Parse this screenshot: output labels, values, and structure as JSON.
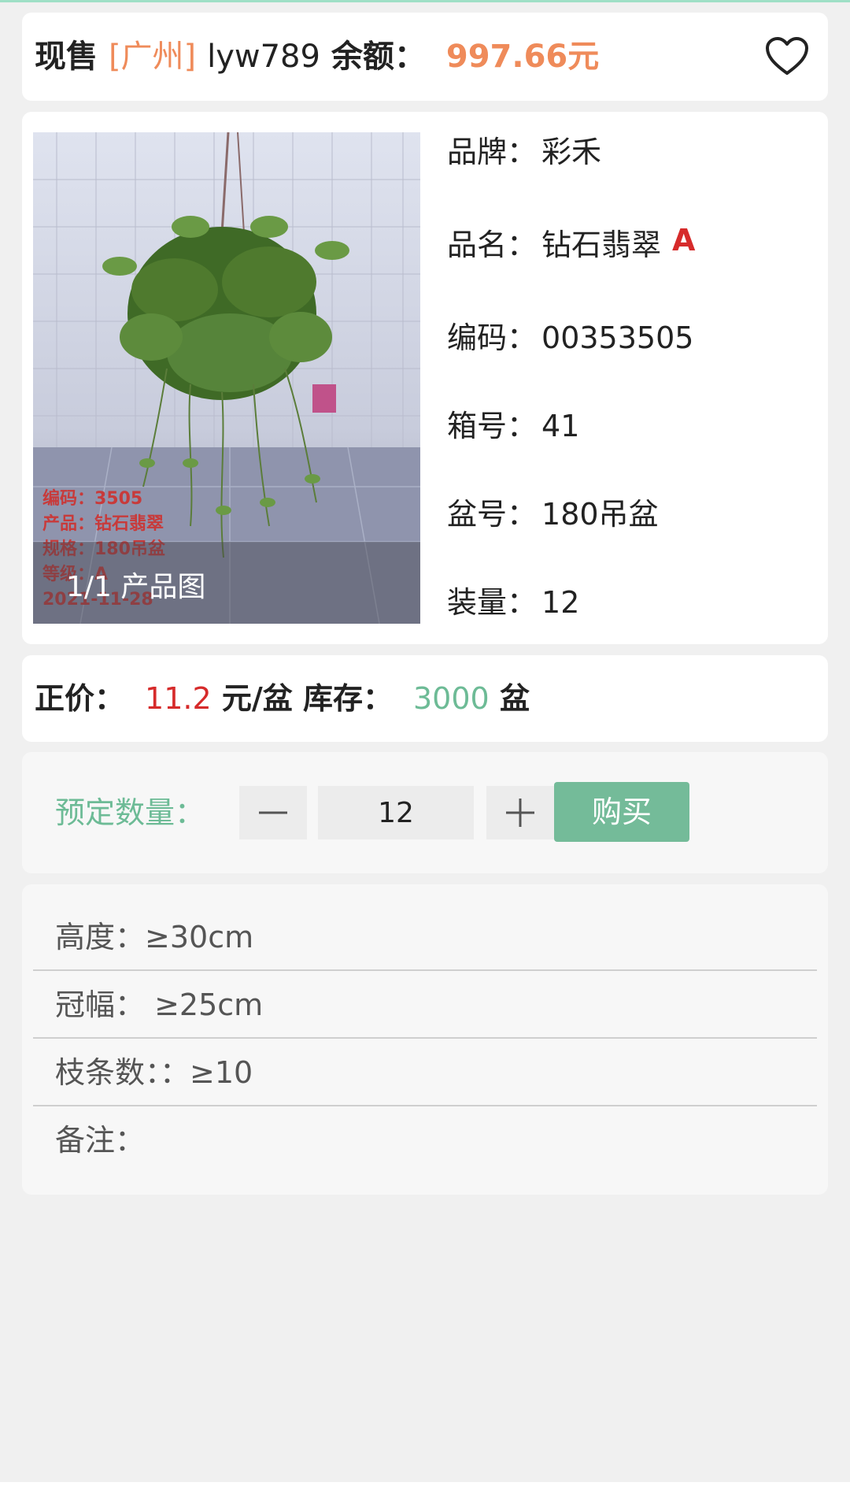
{
  "header": {
    "sale_type": "现售",
    "city": "[广州]",
    "username": "lyw789",
    "balance_label": "余额：",
    "balance_value": "997.66元",
    "favorite_icon": "heart-outline-icon"
  },
  "product": {
    "photo_caption": "1/1 产品图",
    "photo_watermark": [
      "编码：3505",
      "产品：钻石翡翠",
      "规格：180吊盆",
      "等级：A",
      "2021-11-28"
    ],
    "specs": [
      {
        "label": "品牌：",
        "value": "彩禾"
      },
      {
        "label": "品名：",
        "value": "钻石翡翠",
        "grade": "A"
      },
      {
        "label": "编码：",
        "value": "00353505"
      },
      {
        "label": "箱号：",
        "value": "41"
      },
      {
        "label": "盆号：",
        "value": "180吊盆"
      },
      {
        "label": "装量：",
        "value": "12"
      }
    ]
  },
  "price": {
    "price_label": "正价：",
    "price_value": "11.2",
    "price_unit": "元/盆",
    "stock_label": "库存：",
    "stock_value": "3000",
    "stock_unit": "盆"
  },
  "order": {
    "qty_label": "预定数量：",
    "qty_value": "12",
    "minus_icon": "minus-icon",
    "plus_icon": "plus-icon",
    "buy_label": "购买"
  },
  "attributes": [
    {
      "label": "高度：",
      "value": "≥30cm"
    },
    {
      "label": "冠幅：",
      "value": " ≥25cm"
    },
    {
      "label": "枝条数：",
      "value": "：≥10"
    },
    {
      "label": "备注：",
      "value": ""
    }
  ],
  "colors": {
    "accent_orange": "#ef8b5a",
    "accent_green": "#6dbb96",
    "price_red": "#d62b2b",
    "buy_button": "#74bb99"
  }
}
